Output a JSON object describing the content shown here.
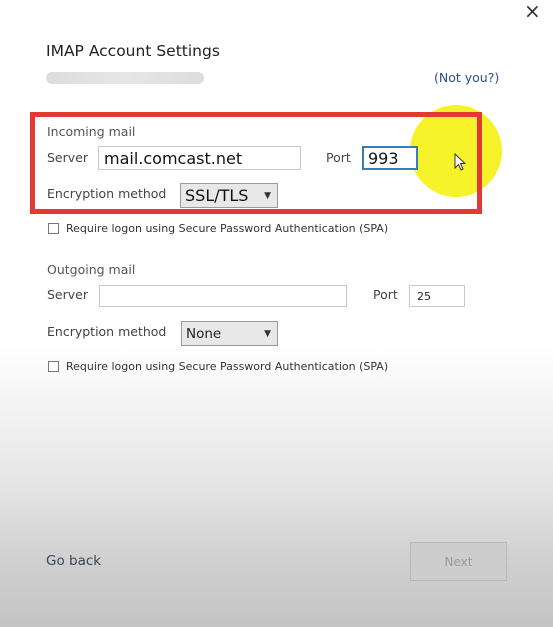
{
  "dialog": {
    "title": "IMAP Account Settings",
    "close_icon": "×",
    "not_you_link": "(Not you?)"
  },
  "incoming": {
    "section_label": "Incoming mail",
    "server_label": "Server",
    "server_value": "mail.comcast.net",
    "port_label": "Port",
    "port_value": "993",
    "encryption_label": "Encryption method",
    "encryption_value": "SSL/TLS",
    "spa_label": "Require logon using Secure Password Authentication (SPA)",
    "spa_checked": false
  },
  "outgoing": {
    "section_label": "Outgoing mail",
    "server_label": "Server",
    "server_value": "",
    "port_label": "Port",
    "port_value": "25",
    "encryption_label": "Encryption method",
    "encryption_value": "None",
    "spa_label": "Require logon using Secure Password Authentication (SPA)",
    "spa_checked": false
  },
  "footer": {
    "go_back_label": "Go back",
    "next_label": "Next"
  },
  "colors": {
    "highlight_box": "#e23a32",
    "cursor_highlight": "#f6f11f",
    "link": "#2b4f86"
  }
}
